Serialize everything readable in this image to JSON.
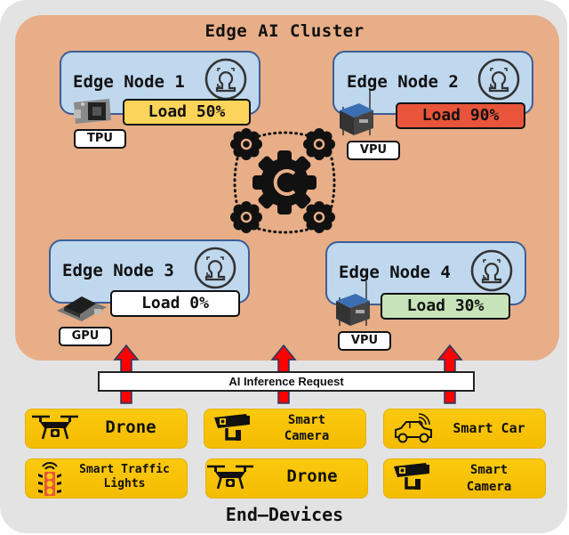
{
  "diagram": {
    "cluster_title": "Edge AI Cluster",
    "footer_title": "End–Devices",
    "request_label": "AI Inference Request",
    "orchestrator_icon": "gear-orchestrator-icon",
    "nodes": [
      {
        "label": "Edge Node 1",
        "load_label": "Load 50%",
        "load_percent": 50,
        "load_color": "#fcd45a",
        "hardware": "TPU",
        "hardware_icon": "tpu-board-icon",
        "model_icon": "face-recognition-icon"
      },
      {
        "label": "Edge Node 2",
        "load_label": "Load 90%",
        "load_percent": 90,
        "load_color": "#e8553a",
        "hardware": "VPU",
        "hardware_icon": "vpu-box-icon",
        "model_icon": "face-recognition-icon"
      },
      {
        "label": "Edge Node 3",
        "load_label": "Load 0%",
        "load_percent": 0,
        "load_color": "#ffffff",
        "hardware": "GPU",
        "hardware_icon": "gpu-board-icon",
        "model_icon": "face-recognition-icon"
      },
      {
        "label": "Edge Node 4",
        "load_label": "Load 30%",
        "load_percent": 30,
        "load_color": "#c7e3b9",
        "hardware": "VPU",
        "hardware_icon": "vpu-box-icon",
        "model_icon": "face-recognition-icon"
      }
    ],
    "devices": [
      {
        "line1": "Drone",
        "line2": "",
        "icon": "drone-icon"
      },
      {
        "line1": "Smart",
        "line2": "Camera",
        "icon": "security-camera-icon"
      },
      {
        "line1": "Smart Car",
        "line2": "",
        "icon": "smart-car-icon"
      },
      {
        "line1": "Smart Traffic",
        "line2": "Lights",
        "icon": "traffic-light-icon"
      },
      {
        "line1": "Drone",
        "line2": "",
        "icon": "drone-icon"
      },
      {
        "line1": "Smart",
        "line2": "Camera",
        "icon": "security-camera-icon"
      }
    ],
    "colors": {
      "background": "#e3e3e3",
      "cluster": "#e8ae88",
      "node": "#bfd8ee",
      "node_border": "#3c5e96",
      "device": "#fbc90f",
      "arrow": "#ff0000"
    }
  }
}
